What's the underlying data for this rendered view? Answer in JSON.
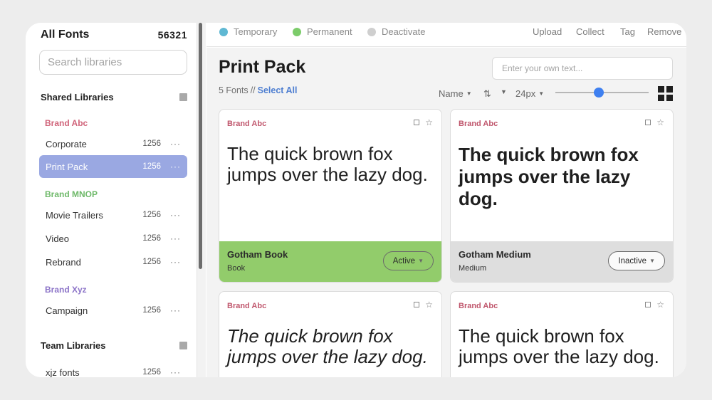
{
  "sidebar": {
    "title": "All Fonts",
    "count": "56321",
    "search_placeholder": "Search libraries",
    "shared_title": "Shared Libraries",
    "team_title": "Team Libraries",
    "brands": [
      {
        "name": "Brand Abc",
        "color": "#d0647a"
      },
      {
        "name": "Brand MNOP",
        "color": "#6fb96a"
      },
      {
        "name": "Brand Xyz",
        "color": "#8c74c8"
      }
    ],
    "items": [
      {
        "name": "Corporate",
        "count": "1256",
        "more": "···"
      },
      {
        "name": "Print Pack",
        "count": "1256",
        "more": "···"
      },
      {
        "name": "Movie Trailers",
        "count": "1256",
        "more": "···"
      },
      {
        "name": "Video",
        "count": "1256",
        "more": "···"
      },
      {
        "name": "Rebrand",
        "count": "1256",
        "more": "···"
      },
      {
        "name": "Campaign",
        "count": "1256",
        "more": "···"
      },
      {
        "name": "xjz fonts",
        "count": "1256",
        "more": "···"
      }
    ],
    "active_color": "#9aa8e2"
  },
  "topbar": {
    "legend": [
      {
        "label": "Temporary",
        "color": "#5fb8d3"
      },
      {
        "label": "Permanent",
        "color": "#7ccc6a"
      },
      {
        "label": "Deactivate",
        "color": "#cfcfcf"
      }
    ],
    "actions": [
      "Upload",
      "Collect",
      "Tag",
      "Remove"
    ]
  },
  "main": {
    "title": "Print Pack",
    "font_count": "5 Fonts",
    "separator": "//",
    "select_all": "Select All",
    "custom_text_placeholder": "Enter your own text...",
    "sort_label": "Name",
    "sort_icon": "sort-arrows-icon",
    "size_label": "24px",
    "size_slider_level": 0.47
  },
  "cards": [
    {
      "brand": "Brand Abc",
      "sample": "The quick brown fox jumps over the lazy dog.",
      "font": "Gotham Book",
      "style": "Book",
      "status": "Active",
      "status_color": "#92cc6b"
    },
    {
      "brand": "Brand Abc",
      "sample": "The quick brown fox jumps over the lazy dog.",
      "font": "Gotham Medium",
      "style": "Medium",
      "status": "Inactive",
      "status_color": "#dedede"
    },
    {
      "brand": "Brand Abc",
      "sample": "The quick brown fox jumps over the lazy dog."
    },
    {
      "brand": "Brand Abc",
      "sample": "The quick brown fox jumps over the lazy dog."
    }
  ]
}
